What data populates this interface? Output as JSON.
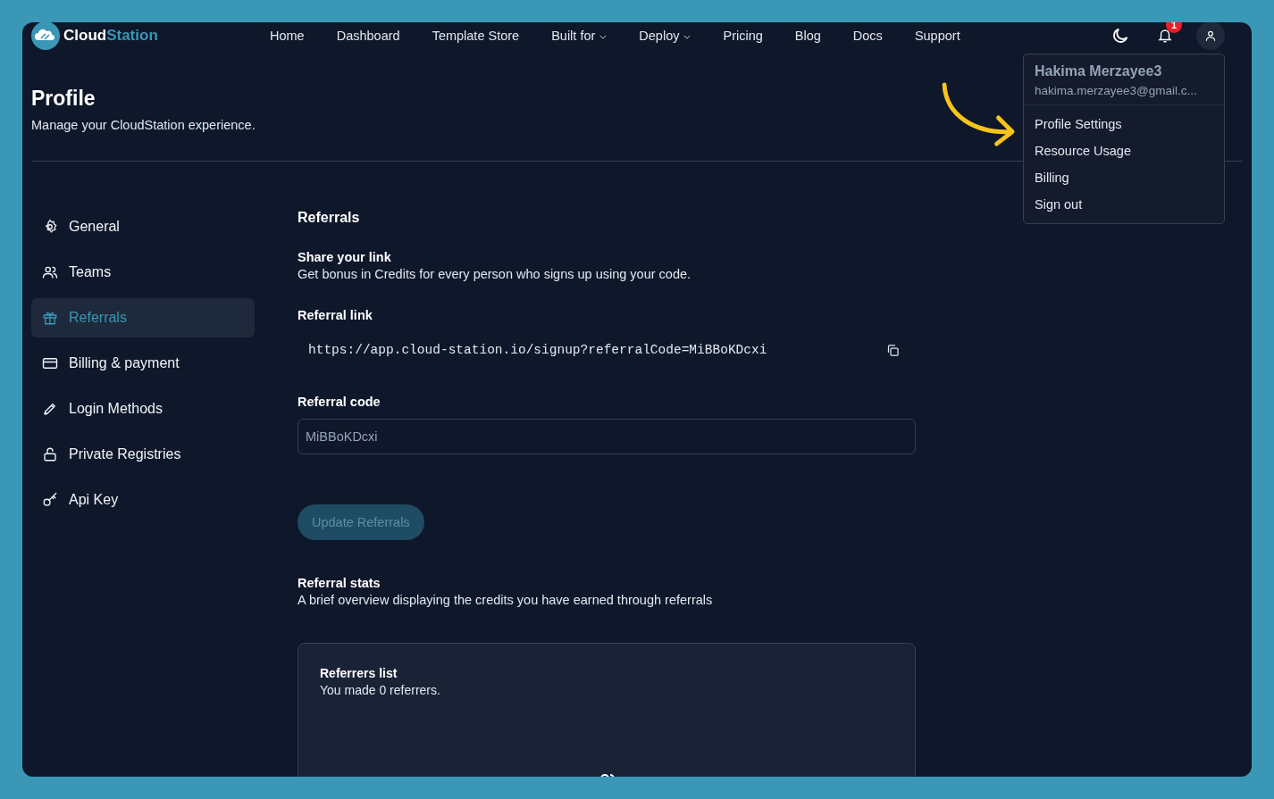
{
  "brand": {
    "name_first": "Cloud",
    "name_second": "Station"
  },
  "nav": [
    {
      "label": "Home",
      "kind": "link"
    },
    {
      "label": "Dashboard",
      "kind": "link"
    },
    {
      "label": "Template Store",
      "kind": "link"
    },
    {
      "label": "Built for",
      "kind": "dropdown"
    },
    {
      "label": "Deploy",
      "kind": "dropdown"
    },
    {
      "label": "Pricing",
      "kind": "link"
    },
    {
      "label": "Blog",
      "kind": "link"
    },
    {
      "label": "Docs",
      "kind": "link"
    },
    {
      "label": "Support",
      "kind": "link"
    }
  ],
  "notifications": {
    "count": "1"
  },
  "user_menu": {
    "name": "Hakima Merzayee3",
    "email": "hakima.merzayee3@gmail.c...",
    "items": [
      {
        "label": "Profile Settings"
      },
      {
        "label": "Resource Usage"
      },
      {
        "label": "Billing"
      },
      {
        "label": "Sign out"
      }
    ]
  },
  "page": {
    "title": "Profile",
    "subtitle": "Manage your CloudStation experience."
  },
  "sidebar": {
    "items": [
      {
        "label": "General",
        "selected": false
      },
      {
        "label": "Teams",
        "selected": false
      },
      {
        "label": "Referrals",
        "selected": true
      },
      {
        "label": "Billing & payment",
        "selected": false
      },
      {
        "label": "Login Methods",
        "selected": false
      },
      {
        "label": "Private Registries",
        "selected": false
      },
      {
        "label": "Api Key",
        "selected": false
      }
    ]
  },
  "referrals": {
    "title": "Referrals",
    "share_heading": "Share your link",
    "share_text": "Get bonus in Credits for every person who signs up using your code.",
    "link_label": "Referral link",
    "link": "https://app.cloud-station.io/signup?referralCode=MiBBoKDcxi",
    "code_label": "Referral code",
    "code": "MiBBoKDcxi",
    "update_button": {
      "label": "Update Referrals",
      "disabled": true
    },
    "stats_heading": "Referral stats",
    "stats_text": "A brief overview displaying the credits you have earned through referrals",
    "list_title": "Referrers list",
    "list_text": "You made 0 referrers."
  }
}
